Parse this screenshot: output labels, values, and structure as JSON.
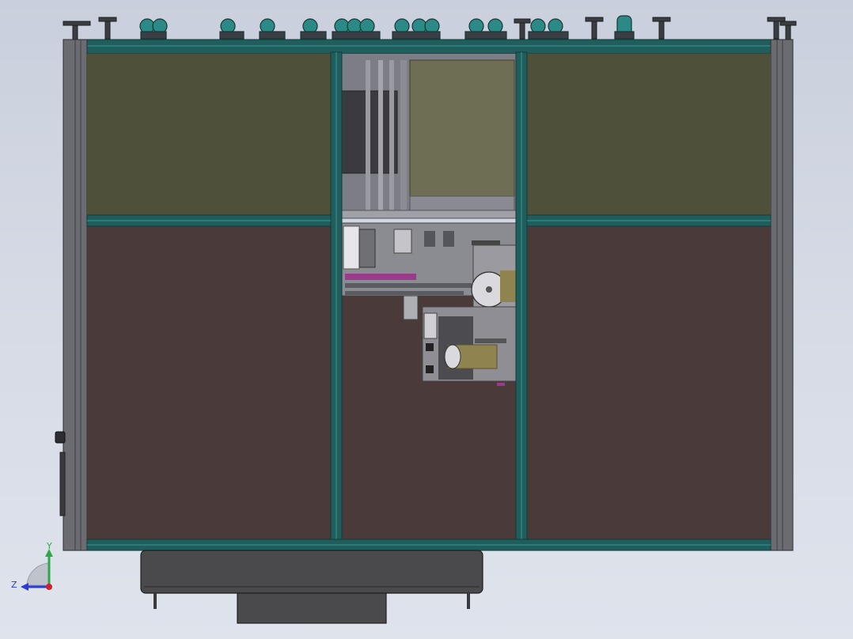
{
  "view": {
    "background_top": "#c9cfdc",
    "background_bottom": "#dfe3ec"
  },
  "colors": {
    "frame_teal": "#1f5e5c",
    "frame_teal_light": "#2f8481",
    "upper_panel": "#4e503a",
    "lower_panel": "#4a3a3a",
    "center_upper_panel": "#6e6e55",
    "post_gray": "#6b6b72",
    "base_gray": "#4a4a4c",
    "machine_gray": "#8a8a90",
    "roll_gold": "#8f8450",
    "accent_magenta": "#9a3a8a"
  },
  "triad": {
    "y_label": "Y",
    "z_label": "Z",
    "y_color": "#2fa84a",
    "z_color": "#2a3bd8",
    "x_color": "#d0202a"
  }
}
